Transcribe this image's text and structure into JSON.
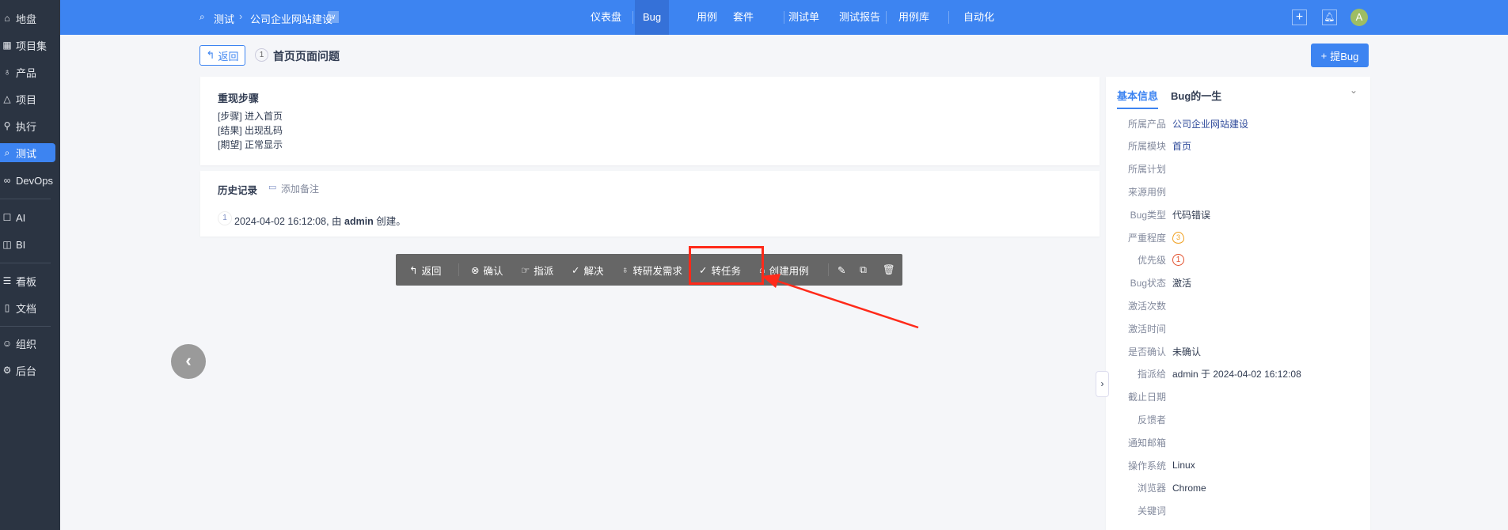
{
  "sidebar": {
    "items": [
      {
        "label": "地盘",
        "icon": "home-icon"
      },
      {
        "label": "项目集",
        "icon": "grid-icon"
      },
      {
        "label": "产品",
        "icon": "bulb-icon"
      },
      {
        "label": "项目",
        "icon": "rocket-icon"
      },
      {
        "label": "执行",
        "icon": "run-icon"
      },
      {
        "label": "测试",
        "icon": "search-icon"
      },
      {
        "label": "DevOps",
        "icon": "infinity-icon"
      },
      {
        "label": "AI",
        "icon": "robot-icon"
      },
      {
        "label": "BI",
        "icon": "chart-icon"
      },
      {
        "label": "看板",
        "icon": "kanban-icon"
      },
      {
        "label": "文档",
        "icon": "doc-icon"
      },
      {
        "label": "组织",
        "icon": "users-icon"
      },
      {
        "label": "后台",
        "icon": "gear-icon"
      }
    ]
  },
  "topbar": {
    "breadcrumb_module": "测试",
    "breadcrumb_product": "公司企业网站建设",
    "nav": [
      "仪表盘",
      "Bug",
      "用例",
      "套件",
      "测试单",
      "测试报告",
      "用例库",
      "自动化"
    ],
    "avatar": "A"
  },
  "header": {
    "back_label": "返回",
    "bug_id": "1",
    "bug_title": "首页页面问题",
    "report_bug_label": "提Bug"
  },
  "steps": {
    "title": "重现步骤",
    "lines": [
      "[步骤] 进入首页",
      "[结果] 出现乱码",
      "[期望] 正常显示"
    ]
  },
  "history": {
    "title": "历史记录",
    "add_note": "添加备注",
    "entries": [
      {
        "num": "1",
        "time": "2024-04-02 16:12:08, 由 ",
        "user": "admin",
        "action": " 创建。"
      }
    ]
  },
  "toolbar": {
    "back": "返回",
    "confirm": "确认",
    "assign": "指派",
    "resolve": "解决",
    "to_story": "转研发需求",
    "to_task": "转任务",
    "create_case": "创建用例"
  },
  "panel": {
    "tabs": [
      "基本信息",
      "Bug的一生"
    ],
    "rows": [
      {
        "label": "所属产品",
        "value": "公司企业网站建设"
      },
      {
        "label": "所属模块",
        "value": "首页"
      },
      {
        "label": "所属计划",
        "value": ""
      },
      {
        "label": "来源用例",
        "value": ""
      },
      {
        "label": "Bug类型",
        "value": "代码错误"
      },
      {
        "label": "严重程度",
        "value": "3"
      },
      {
        "label": "优先级",
        "value": "1"
      },
      {
        "label": "Bug状态",
        "value": "激活"
      },
      {
        "label": "激活次数",
        "value": ""
      },
      {
        "label": "激活时间",
        "value": ""
      },
      {
        "label": "是否确认",
        "value": "未确认"
      },
      {
        "label": "指派给",
        "value": "admin 于 2024-04-02 16:12:08"
      },
      {
        "label": "截止日期",
        "value": ""
      },
      {
        "label": "反馈者",
        "value": ""
      },
      {
        "label": "通知邮箱",
        "value": ""
      },
      {
        "label": "操作系统",
        "value": "Linux"
      },
      {
        "label": "浏览器",
        "value": "Chrome"
      },
      {
        "label": "关键词",
        "value": ""
      }
    ]
  },
  "colors": {
    "primary": "#3d84f1",
    "sidebar": "#2b3442",
    "toolbar": "#666666",
    "highlight": "#ff2a1a"
  }
}
